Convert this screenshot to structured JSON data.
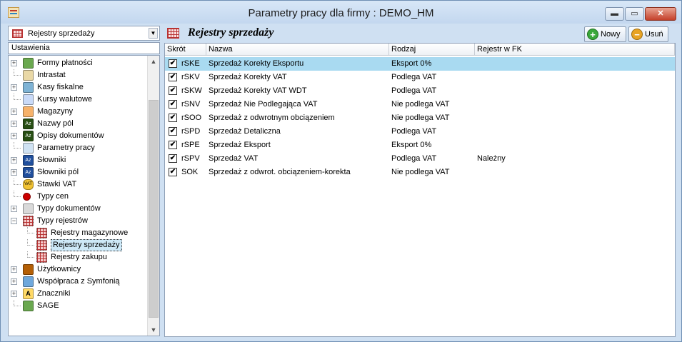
{
  "window": {
    "title": "Parametry pracy dla firmy : DEMO_HM",
    "min_glyph": "▬",
    "max_glyph": "▭",
    "close_glyph": "✕"
  },
  "left": {
    "combo_value": "Rejestry sprzedaży",
    "tree_header": "Ustawienia",
    "tree": [
      {
        "label": "Formy płatności",
        "expandable": true,
        "expanded": false,
        "level": 0,
        "icon": "payment-icon"
      },
      {
        "label": "Intrastat",
        "expandable": false,
        "level": 0,
        "icon": "intrastat-icon"
      },
      {
        "label": "Kasy fiskalne",
        "expandable": true,
        "expanded": false,
        "level": 0,
        "icon": "cash-register-icon"
      },
      {
        "label": "Kursy walutowe",
        "expandable": false,
        "level": 0,
        "icon": "exchange-rate-icon"
      },
      {
        "label": "Magazyny",
        "expandable": true,
        "expanded": false,
        "level": 0,
        "icon": "warehouse-icon"
      },
      {
        "label": "Nazwy pól",
        "expandable": true,
        "expanded": false,
        "level": 0,
        "icon": "az-dark-icon"
      },
      {
        "label": "Opisy dokumentów",
        "expandable": true,
        "expanded": false,
        "level": 0,
        "icon": "az-dark-icon"
      },
      {
        "label": "Parametry pracy",
        "expandable": false,
        "level": 0,
        "icon": "settings-icon"
      },
      {
        "label": "Słowniki",
        "expandable": true,
        "expanded": false,
        "level": 0,
        "icon": "az-blue-icon"
      },
      {
        "label": "Słowniki pól",
        "expandable": true,
        "expanded": false,
        "level": 0,
        "icon": "az-blue-icon"
      },
      {
        "label": "Stawki VAT",
        "expandable": false,
        "level": 0,
        "icon": "vat-icon"
      },
      {
        "label": "Typy cen",
        "expandable": false,
        "level": 0,
        "icon": "price-icon"
      },
      {
        "label": "Typy dokumentów",
        "expandable": true,
        "expanded": false,
        "level": 0,
        "icon": "documents-icon"
      },
      {
        "label": "Typy rejestrów",
        "expandable": true,
        "expanded": true,
        "level": 0,
        "icon": "register-icon"
      },
      {
        "label": "Rejestry magazynowe",
        "expandable": false,
        "level": 1,
        "icon": "register-icon"
      },
      {
        "label": "Rejestry sprzedaży",
        "expandable": false,
        "level": 1,
        "icon": "register-icon",
        "selected": true
      },
      {
        "label": "Rejestry zakupu",
        "expandable": false,
        "level": 1,
        "icon": "register-icon"
      },
      {
        "label": "Użytkownicy",
        "expandable": true,
        "expanded": false,
        "level": 0,
        "icon": "users-icon"
      },
      {
        "label": "Współpraca z Symfonią",
        "expandable": true,
        "expanded": false,
        "level": 0,
        "icon": "sync-icon"
      },
      {
        "label": "Znaczniki",
        "expandable": true,
        "expanded": false,
        "level": 0,
        "icon": "tag-icon"
      },
      {
        "label": "SAGE",
        "expandable": false,
        "level": 0,
        "icon": "sage-icon"
      }
    ],
    "expand_glyph": "+",
    "collapse_glyph": "−",
    "scroll_up": "▲",
    "scroll_down": "▼"
  },
  "right": {
    "title": "Rejestry sprzedaży",
    "new_label": "Nowy",
    "delete_label": "Usuń",
    "new_glyph": "+",
    "delete_glyph": "−",
    "columns": [
      "Skrót",
      "Nazwa",
      "Rodzaj",
      "Rejestr w FK"
    ],
    "checked_glyph": "✔",
    "rows": [
      {
        "checked": true,
        "skrot": "rSKE",
        "nazwa": "Sprzedaż Korekty Eksportu",
        "rodzaj": "Eksport 0%",
        "fk": "",
        "selected": true
      },
      {
        "checked": true,
        "skrot": "rSKV",
        "nazwa": "Sprzedaż Korekty VAT",
        "rodzaj": "Podlega VAT",
        "fk": ""
      },
      {
        "checked": true,
        "skrot": "rSKW",
        "nazwa": "Sprzedaż Korekty VAT WDT",
        "rodzaj": "Podlega VAT",
        "fk": ""
      },
      {
        "checked": true,
        "skrot": "rSNV",
        "nazwa": "Sprzedaż Nie Podlegająca VAT",
        "rodzaj": "Nie podlega VAT",
        "fk": ""
      },
      {
        "checked": true,
        "skrot": "rSOO",
        "nazwa": "Sprzedaż z odwrotnym obciązeniem",
        "rodzaj": "Nie podlega VAT",
        "fk": ""
      },
      {
        "checked": true,
        "skrot": "rSPD",
        "nazwa": "Sprzedaż Detaliczna",
        "rodzaj": "Podlega VAT",
        "fk": ""
      },
      {
        "checked": true,
        "skrot": "rSPE",
        "nazwa": "Sprzedaż Eksport",
        "rodzaj": "Eksport 0%",
        "fk": ""
      },
      {
        "checked": true,
        "skrot": "rSPV",
        "nazwa": "Sprzedaż VAT",
        "rodzaj": "Podlega VAT",
        "fk": "Należny"
      },
      {
        "checked": true,
        "skrot": "SOK",
        "nazwa": "Sprzedaż z odwrot. obciązeniem-korekta",
        "rodzaj": "Nie podlega VAT",
        "fk": ""
      }
    ]
  }
}
